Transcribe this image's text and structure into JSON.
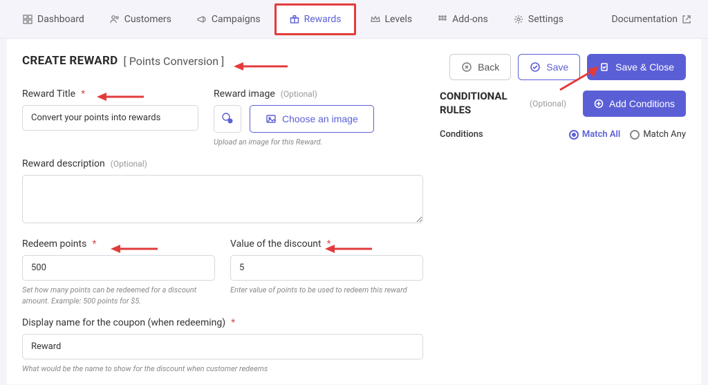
{
  "nav": {
    "items": [
      {
        "label": "Dashboard",
        "icon": "dashboard"
      },
      {
        "label": "Customers",
        "icon": "users"
      },
      {
        "label": "Campaigns",
        "icon": "megaphone"
      },
      {
        "label": "Rewards",
        "icon": "gift",
        "active": true
      },
      {
        "label": "Levels",
        "icon": "crown"
      },
      {
        "label": "Add-ons",
        "icon": "grid"
      },
      {
        "label": "Settings",
        "icon": "gear"
      }
    ],
    "doc_label": "Documentation"
  },
  "header": {
    "title": "CREATE REWARD",
    "subtitle": "[ Points Conversion ]"
  },
  "actions": {
    "back": "Back",
    "save": "Save",
    "save_close": "Save & Close"
  },
  "form": {
    "title_label": "Reward Title",
    "title_value": "Convert your points into rewards",
    "image_label": "Reward image",
    "image_optional": "(Optional)",
    "image_choose": "Choose an image",
    "image_helper": "Upload an image for this Reward.",
    "desc_label": "Reward description",
    "desc_optional": "(Optional)",
    "desc_value": "",
    "redeem_label": "Redeem points",
    "redeem_value": "500",
    "redeem_helper": "Set how many points can be redeemed for a discount amount. Example: 500 points for $5.",
    "discount_label": "Value of the discount",
    "discount_value": "5",
    "discount_helper": "Enter value of points to be used to redeem this reward",
    "display_label": "Display name for the coupon (when redeeming)",
    "display_value": "Reward",
    "display_helper": "What would be the name to show for the discount when customer redeems"
  },
  "rules": {
    "title": "CONDITIONAL RULES",
    "optional": "(Optional)",
    "add": "Add Conditions",
    "cond_label": "Conditions",
    "match_all": "Match All",
    "match_any": "Match Any"
  }
}
